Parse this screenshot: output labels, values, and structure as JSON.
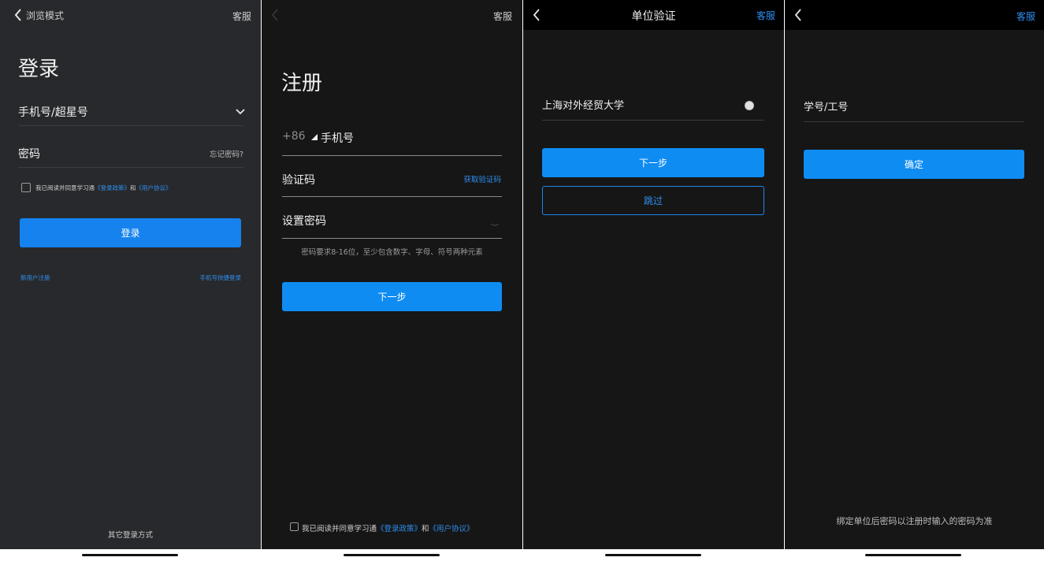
{
  "login": {
    "back_label": "浏览模式",
    "service_label": "客服",
    "title": "登录",
    "account_placeholder": "手机号/超星号",
    "password_label": "密码",
    "forgot_password": "忘记密码?",
    "agree_prefix": "我已阅读并同意学习通",
    "agree_link1": "《登录政策》",
    "agree_and": "和",
    "agree_link2": "《用户协议》",
    "login_button": "登录",
    "new_user_register": "新用户注册",
    "phone_quick_login": "手机号快捷登录",
    "other_login_methods": "其它登录方式"
  },
  "register": {
    "service_label": "客服",
    "title": "注册",
    "country_code": "+86",
    "phone_placeholder": "手机号",
    "verify_code_label": "验证码",
    "get_verify_code": "获取验证码",
    "set_password_label": "设置密码",
    "password_hint": "密码要求8-16位，至少包含数字、字母、符号两种元素",
    "next_button": "下一步",
    "agree_prefix": "我已阅读并同意学习通",
    "agree_link1": "《登录政策》",
    "agree_and": "和",
    "agree_link2": "《用户协议》"
  },
  "unit_verify": {
    "title": "单位验证",
    "service_label": "客服",
    "unit_name": "上海对外经贸大学",
    "next_button": "下一步",
    "skip_button": "跳过"
  },
  "id_bind": {
    "service_label": "客服",
    "id_placeholder": "学号/工号",
    "confirm_button": "确定",
    "footer_note": "绑定单位后密码以注册时输入的密码为准"
  },
  "colors": {
    "accent": "#1582ee",
    "link": "#2e8ff0",
    "panel_login_bg": "#28292c",
    "panel_dark_bg": "#161616"
  }
}
